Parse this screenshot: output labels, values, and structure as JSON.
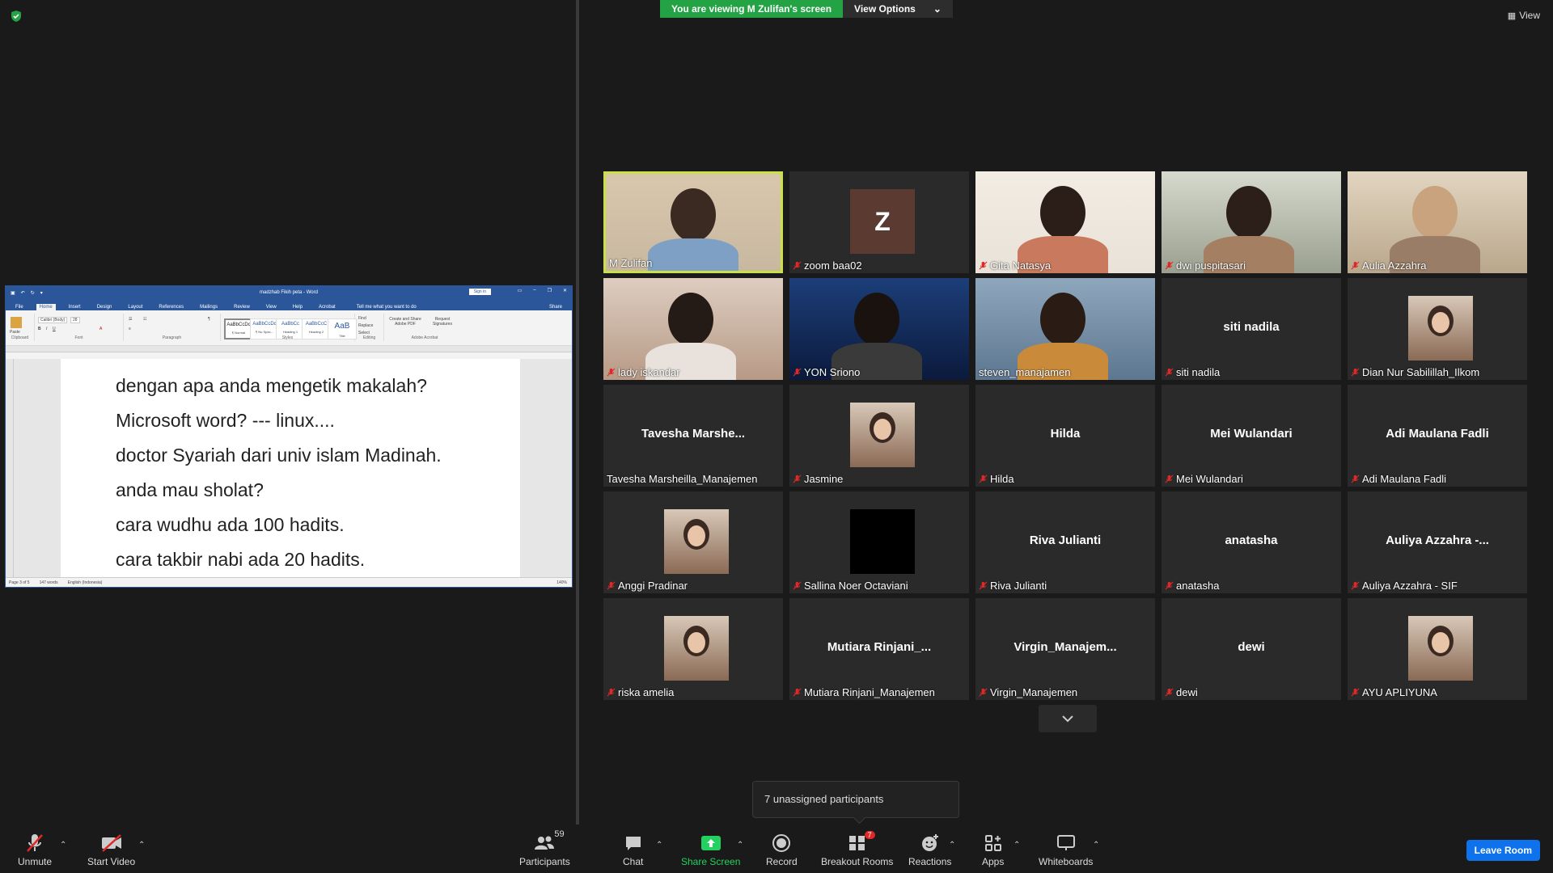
{
  "banner": {
    "viewing": "You are viewing M Zulifan's screen",
    "view_options": "View Options"
  },
  "view_button": "View",
  "word": {
    "doc_title": "madzhab Fikih peta  -  Word",
    "sign_in": "Sign in",
    "tabs": [
      "File",
      "Home",
      "Insert",
      "Design",
      "Layout",
      "References",
      "Mailings",
      "Review",
      "View",
      "Help",
      "Acrobat"
    ],
    "tell_me": "Tell me what you want to do",
    "share": "Share",
    "font_name": "Calibri (Body)",
    "font_size": "28",
    "groups": [
      "Clipboard",
      "Font",
      "Paragraph",
      "Styles",
      "Editing",
      "Adobe Acrobat"
    ],
    "styles": [
      {
        "sample": "AaBbCcDc",
        "name": "¶ Normal"
      },
      {
        "sample": "AaBbCcDc",
        "name": "¶ No Spac..."
      },
      {
        "sample": "AaBbCc",
        "name": "Heading 1"
      },
      {
        "sample": "AaBbCcC",
        "name": "Heading 2"
      },
      {
        "sample": "AaB",
        "name": "Title"
      }
    ],
    "editing": [
      "Find",
      "Replace",
      "Select"
    ],
    "acrobat": [
      "Create and Share Adobe PDF",
      "Request Signatures"
    ],
    "paste": "Paste",
    "lines": [
      "dengan apa anda mengetik makalah?",
      "Microsoft word? --- linux....",
      "doctor Syariah dari univ islam Madinah.",
      "anda mau sholat?",
      "cara wudhu ada 100 hadits.",
      "cara takbir nabi ada 20 hadits."
    ],
    "status": {
      "page": "Page 3 of 5",
      "words": "147 words",
      "language": "English (Indonesia)",
      "zoom": "140%"
    }
  },
  "participants": [
    {
      "name": "M Zulifan",
      "kind": "video",
      "muted": false,
      "active": true
    },
    {
      "name": "zoom baa02",
      "kind": "letter",
      "letter": "Z",
      "muted": true
    },
    {
      "name": "Gita Natasya",
      "kind": "video",
      "muted": true
    },
    {
      "name": "dwi puspitasari",
      "kind": "video",
      "muted": true
    },
    {
      "name": "Aulia Azzahra",
      "kind": "video",
      "muted": true
    },
    {
      "name": "lady iskandar",
      "kind": "video",
      "muted": true
    },
    {
      "name": "YON Sriono",
      "kind": "video",
      "muted": true
    },
    {
      "name": "steven_manajamen",
      "kind": "video",
      "muted": false
    },
    {
      "name": "siti nadila",
      "kind": "text",
      "display": "siti nadila",
      "muted": true
    },
    {
      "name": "Dian Nur Sabilillah_Ilkom",
      "kind": "photo",
      "muted": true
    },
    {
      "name": "Tavesha Marsheilla_Manajemen",
      "kind": "text",
      "display": "Tavesha  Marshe...",
      "muted": false
    },
    {
      "name": "Jasmine",
      "kind": "photo",
      "muted": true
    },
    {
      "name": "Hilda",
      "kind": "text",
      "display": "Hilda",
      "muted": true
    },
    {
      "name": "Mei Wulandari",
      "kind": "text",
      "display": "Mei Wulandari",
      "muted": true
    },
    {
      "name": "Adi Maulana Fadli",
      "kind": "text",
      "display": "Adi Maulana Fadli",
      "muted": true
    },
    {
      "name": "Anggi Pradinar",
      "kind": "photo",
      "muted": true
    },
    {
      "name": "Sallina Noer Octaviani",
      "kind": "black",
      "muted": true
    },
    {
      "name": "Riva Julianti",
      "kind": "text",
      "display": "Riva Julianti",
      "muted": true
    },
    {
      "name": "anatasha",
      "kind": "text",
      "display": "anatasha",
      "muted": true
    },
    {
      "name": "Auliya Azzahra - SIF",
      "kind": "text",
      "display": "Auliya  Azzahra -...",
      "muted": true
    },
    {
      "name": "riska amelia",
      "kind": "photo",
      "muted": true
    },
    {
      "name": "Mutiara Rinjani_Manajemen",
      "kind": "text",
      "display": "Mutiara  Rinjani_...",
      "muted": true
    },
    {
      "name": "Virgin_Manajemen",
      "kind": "text",
      "display": "Virgin_Manajem...",
      "muted": true
    },
    {
      "name": "dewi",
      "kind": "text",
      "display": "dewi",
      "muted": true
    },
    {
      "name": "AYU APLIYUNA",
      "kind": "photo",
      "muted": true
    }
  ],
  "tooltip": "7 unassigned participants",
  "toolbar": {
    "unmute": "Unmute",
    "start_video": "Start Video",
    "participants": "Participants",
    "participants_count": "59",
    "chat": "Chat",
    "share_screen": "Share Screen",
    "record": "Record",
    "breakout_rooms": "Breakout Rooms",
    "breakout_badge": "7",
    "reactions": "Reactions",
    "apps": "Apps",
    "whiteboards": "Whiteboards",
    "leave": "Leave Room"
  },
  "colors": {
    "accent_green": "#23a344",
    "active_speaker": "#c9e04b",
    "leave_blue": "#0e72ed",
    "muted_red": "#e02828",
    "word_blue": "#2b579a"
  }
}
